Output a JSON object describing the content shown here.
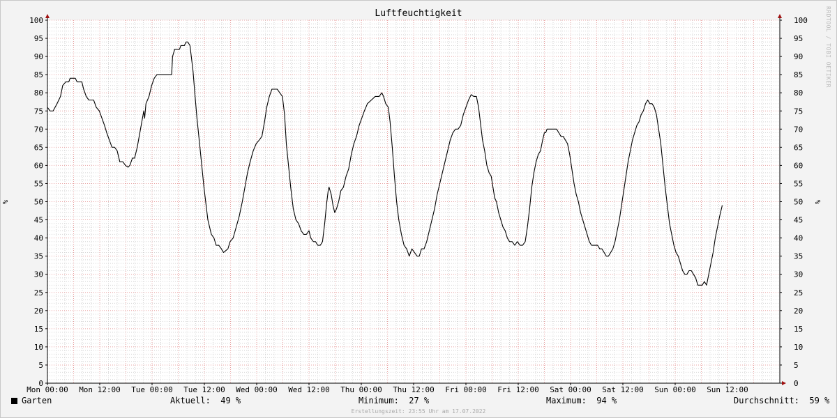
{
  "chart_data": {
    "type": "line",
    "title": "Luftfeuchtigkeit",
    "ylabel": "%",
    "ylim": [
      0,
      100
    ],
    "xlim_hours": [
      0,
      168
    ],
    "yticks": [
      0,
      5,
      10,
      15,
      20,
      25,
      30,
      35,
      40,
      45,
      50,
      55,
      60,
      65,
      70,
      75,
      80,
      85,
      90,
      95,
      100
    ],
    "xticks": [
      {
        "hour": 0,
        "label": "Mon 00:00"
      },
      {
        "hour": 12,
        "label": "Mon 12:00"
      },
      {
        "hour": 24,
        "label": "Tue 00:00"
      },
      {
        "hour": 36,
        "label": "Tue 12:00"
      },
      {
        "hour": 48,
        "label": "Wed 00:00"
      },
      {
        "hour": 60,
        "label": "Wed 12:00"
      },
      {
        "hour": 72,
        "label": "Thu 00:00"
      },
      {
        "hour": 84,
        "label": "Thu 12:00"
      },
      {
        "hour": 96,
        "label": "Fri 00:00"
      },
      {
        "hour": 108,
        "label": "Fri 12:00"
      },
      {
        "hour": 120,
        "label": "Sat 00:00"
      },
      {
        "hour": 132,
        "label": "Sat 12:00"
      },
      {
        "hour": 144,
        "label": "Sun 00:00"
      },
      {
        "hour": 156,
        "label": "Sun 12:00"
      }
    ],
    "grid": true,
    "series": [
      {
        "name": "Garten",
        "color": "#000000",
        "points": [
          [
            0,
            76
          ],
          [
            0.6,
            75
          ],
          [
            1.3,
            75
          ],
          [
            2.2,
            77
          ],
          [
            3,
            79
          ],
          [
            3.5,
            82
          ],
          [
            4.2,
            83
          ],
          [
            4.9,
            83
          ],
          [
            5.2,
            84
          ],
          [
            6.4,
            84
          ],
          [
            6.8,
            83
          ],
          [
            7.9,
            83
          ],
          [
            8.3,
            81
          ],
          [
            8.9,
            79
          ],
          [
            9.5,
            78
          ],
          [
            10.6,
            78
          ],
          [
            11.2,
            76
          ],
          [
            11.9,
            75
          ],
          [
            12.5,
            73
          ],
          [
            13.1,
            71
          ],
          [
            13.6,
            69
          ],
          [
            14.2,
            67
          ],
          [
            14.8,
            65
          ],
          [
            15.4,
            65
          ],
          [
            16,
            64
          ],
          [
            16.6,
            61
          ],
          [
            17.3,
            61
          ],
          [
            17.9,
            60
          ],
          [
            18.5,
            59.5
          ],
          [
            18.9,
            60
          ],
          [
            19.5,
            62
          ],
          [
            20,
            62
          ],
          [
            20.6,
            65
          ],
          [
            21.2,
            69
          ],
          [
            21.8,
            73
          ],
          [
            22.1,
            75
          ],
          [
            22.3,
            73
          ],
          [
            22.6,
            77
          ],
          [
            23.3,
            79
          ],
          [
            23.9,
            82
          ],
          [
            24.5,
            84
          ],
          [
            25.1,
            85
          ],
          [
            26.6,
            85
          ],
          [
            27.9,
            85
          ],
          [
            28.5,
            85
          ],
          [
            28.7,
            90
          ],
          [
            29.2,
            92
          ],
          [
            30.3,
            92
          ],
          [
            30.6,
            93
          ],
          [
            31.4,
            93
          ],
          [
            31.8,
            94
          ],
          [
            32.2,
            94
          ],
          [
            32.7,
            93
          ],
          [
            33,
            90
          ],
          [
            33.4,
            86
          ],
          [
            33.8,
            80
          ],
          [
            34.3,
            73
          ],
          [
            34.9,
            66
          ],
          [
            35.4,
            60
          ],
          [
            35.9,
            54
          ],
          [
            36.4,
            49
          ],
          [
            36.8,
            45
          ],
          [
            37.2,
            43
          ],
          [
            37.6,
            41
          ],
          [
            38.2,
            40
          ],
          [
            38.7,
            38
          ],
          [
            39.3,
            38
          ],
          [
            39.9,
            37
          ],
          [
            40.4,
            36
          ],
          [
            40.9,
            36.5
          ],
          [
            41.4,
            37
          ],
          [
            41.9,
            39
          ],
          [
            42.6,
            40
          ],
          [
            43.3,
            43
          ],
          [
            44,
            46
          ],
          [
            44.7,
            50
          ],
          [
            45.3,
            54
          ],
          [
            45.9,
            58
          ],
          [
            46.5,
            61
          ],
          [
            47.2,
            64
          ],
          [
            47.9,
            66
          ],
          [
            48.6,
            67
          ],
          [
            49.2,
            68
          ],
          [
            49.8,
            72
          ],
          [
            50.3,
            76
          ],
          [
            50.9,
            79
          ],
          [
            51.5,
            81
          ],
          [
            52.7,
            81
          ],
          [
            53.3,
            80
          ],
          [
            53.9,
            79
          ],
          [
            54.4,
            74
          ],
          [
            54.8,
            66
          ],
          [
            55.3,
            60
          ],
          [
            55.8,
            54
          ],
          [
            56.4,
            48
          ],
          [
            57,
            45
          ],
          [
            57.6,
            44
          ],
          [
            58.2,
            42
          ],
          [
            58.8,
            41
          ],
          [
            59.4,
            41
          ],
          [
            60,
            42
          ],
          [
            60.4,
            40
          ],
          [
            61,
            39
          ],
          [
            61.5,
            39
          ],
          [
            62,
            38
          ],
          [
            62.6,
            38
          ],
          [
            63.1,
            39
          ],
          [
            63.6,
            44
          ],
          [
            64,
            49
          ],
          [
            64.4,
            53
          ],
          [
            64.6,
            54
          ],
          [
            65.1,
            52
          ],
          [
            65.5,
            49
          ],
          [
            65.9,
            47
          ],
          [
            66.3,
            48
          ],
          [
            66.8,
            50
          ],
          [
            67.3,
            53
          ],
          [
            67.9,
            54
          ],
          [
            68.5,
            57
          ],
          [
            69.1,
            59
          ],
          [
            69.7,
            63
          ],
          [
            70.3,
            66
          ],
          [
            70.9,
            68
          ],
          [
            71.5,
            71
          ],
          [
            72.1,
            73
          ],
          [
            72.7,
            75
          ],
          [
            73.4,
            77
          ],
          [
            74.3,
            78
          ],
          [
            75.2,
            79
          ],
          [
            76.1,
            79
          ],
          [
            76.7,
            80
          ],
          [
            77.1,
            79
          ],
          [
            77.6,
            77
          ],
          [
            78.2,
            76
          ],
          [
            78.6,
            72
          ],
          [
            79.1,
            65
          ],
          [
            79.6,
            57
          ],
          [
            80.1,
            50
          ],
          [
            80.6,
            45
          ],
          [
            81.2,
            41
          ],
          [
            81.8,
            38
          ],
          [
            82.4,
            37
          ],
          [
            83,
            35
          ],
          [
            83.6,
            37
          ],
          [
            84.2,
            36
          ],
          [
            84.8,
            35
          ],
          [
            85.3,
            35
          ],
          [
            85.8,
            37
          ],
          [
            86.4,
            37
          ],
          [
            87,
            39
          ],
          [
            87.6,
            42
          ],
          [
            88.2,
            45
          ],
          [
            88.8,
            48
          ],
          [
            89.4,
            52
          ],
          [
            90,
            55
          ],
          [
            90.6,
            58
          ],
          [
            91.2,
            61
          ],
          [
            91.8,
            64
          ],
          [
            92.4,
            67
          ],
          [
            93,
            69
          ],
          [
            93.6,
            70
          ],
          [
            94.2,
            70
          ],
          [
            94.8,
            71
          ],
          [
            95.4,
            74
          ],
          [
            96,
            76
          ],
          [
            96.6,
            78
          ],
          [
            97.2,
            79.5
          ],
          [
            97.8,
            79
          ],
          [
            98.4,
            79
          ],
          [
            98.9,
            76
          ],
          [
            99.3,
            72
          ],
          [
            99.8,
            67
          ],
          [
            100.3,
            64
          ],
          [
            100.8,
            60
          ],
          [
            101.3,
            58
          ],
          [
            101.8,
            57
          ],
          [
            102.2,
            54
          ],
          [
            102.6,
            51
          ],
          [
            103,
            50
          ],
          [
            103.5,
            47
          ],
          [
            104,
            45
          ],
          [
            104.5,
            43
          ],
          [
            105,
            42
          ],
          [
            105.5,
            40
          ],
          [
            106,
            39
          ],
          [
            106.6,
            39
          ],
          [
            107.2,
            38
          ],
          [
            107.8,
            39
          ],
          [
            108.4,
            38
          ],
          [
            109,
            38
          ],
          [
            109.6,
            39
          ],
          [
            110.1,
            43
          ],
          [
            110.6,
            48
          ],
          [
            111.1,
            54
          ],
          [
            111.6,
            58
          ],
          [
            112.1,
            61
          ],
          [
            112.6,
            63
          ],
          [
            113.1,
            64
          ],
          [
            113.6,
            67
          ],
          [
            114,
            69
          ],
          [
            114.3,
            69
          ],
          [
            114.6,
            70
          ],
          [
            116.8,
            70
          ],
          [
            117.3,
            69
          ],
          [
            117.8,
            68
          ],
          [
            118.3,
            68
          ],
          [
            118.8,
            67
          ],
          [
            119.3,
            66
          ],
          [
            119.8,
            63
          ],
          [
            120.3,
            59
          ],
          [
            120.8,
            55
          ],
          [
            121.3,
            52
          ],
          [
            121.8,
            50
          ],
          [
            122.3,
            47
          ],
          [
            122.8,
            45
          ],
          [
            123.3,
            43
          ],
          [
            123.8,
            41
          ],
          [
            124.3,
            39
          ],
          [
            124.8,
            38
          ],
          [
            126.2,
            38
          ],
          [
            126.7,
            37
          ],
          [
            127.2,
            37
          ],
          [
            127.7,
            36
          ],
          [
            128.2,
            35
          ],
          [
            128.7,
            35
          ],
          [
            129.2,
            36
          ],
          [
            129.7,
            37
          ],
          [
            130.2,
            39
          ],
          [
            130.7,
            42
          ],
          [
            131.2,
            45
          ],
          [
            131.7,
            49
          ],
          [
            132.2,
            53
          ],
          [
            132.7,
            57
          ],
          [
            133.2,
            61
          ],
          [
            133.7,
            64
          ],
          [
            134.2,
            67
          ],
          [
            134.7,
            69
          ],
          [
            135.2,
            71
          ],
          [
            135.7,
            72
          ],
          [
            136.2,
            74
          ],
          [
            136.7,
            75
          ],
          [
            137.2,
            77
          ],
          [
            137.7,
            78
          ],
          [
            138.2,
            77
          ],
          [
            138.7,
            77
          ],
          [
            139.2,
            76
          ],
          [
            139.7,
            74
          ],
          [
            140.2,
            70
          ],
          [
            140.7,
            66
          ],
          [
            141.2,
            60
          ],
          [
            141.7,
            54
          ],
          [
            142.2,
            49
          ],
          [
            142.7,
            44
          ],
          [
            143.2,
            41
          ],
          [
            143.7,
            38
          ],
          [
            144.2,
            36
          ],
          [
            144.7,
            35
          ],
          [
            145.2,
            33
          ],
          [
            145.7,
            31
          ],
          [
            146.2,
            30
          ],
          [
            146.7,
            30
          ],
          [
            147.2,
            31
          ],
          [
            147.7,
            31
          ],
          [
            148.2,
            30
          ],
          [
            148.7,
            29
          ],
          [
            149.2,
            27
          ],
          [
            149.7,
            27
          ],
          [
            150.2,
            27
          ],
          [
            150.7,
            28
          ],
          [
            151.2,
            27
          ],
          [
            151.7,
            30
          ],
          [
            152.2,
            33
          ],
          [
            152.7,
            36
          ],
          [
            153.2,
            40
          ],
          [
            153.7,
            43
          ],
          [
            154.2,
            46
          ],
          [
            154.8,
            49
          ]
        ]
      }
    ]
  },
  "legend": {
    "series_label": "Garten",
    "current_label": "Aktuell:",
    "current_value": "49 %",
    "min_label": "Minimum:",
    "min_value": "27 %",
    "max_label": "Maximum:",
    "max_value": "94 %",
    "avg_label": "Durchschnitt:",
    "avg_value": "59 %"
  },
  "side_credit": "RRDTOOL / TOBI OETIKER",
  "created_text": "Erstellungszeit: 23:55 Uhr am 17.07.2022",
  "colors": {
    "background": "#f3f3f3",
    "plot_area": "#ffffff",
    "grid_minor": "#d4d4d4",
    "grid_major": "#e8a0a0",
    "axis_arrow": "#a01010",
    "line": "#000000"
  }
}
